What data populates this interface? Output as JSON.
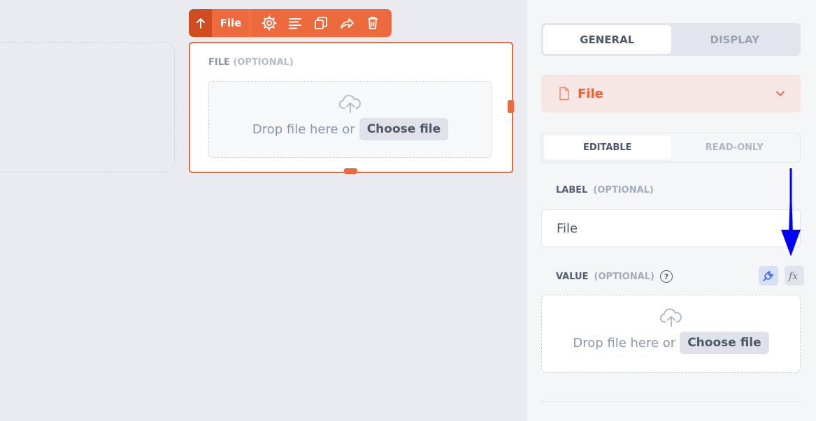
{
  "toolbar": {
    "field_name": "File",
    "icons": [
      "arrow-up-icon",
      "gear-icon",
      "align-left-icon",
      "copy-icon",
      "share-icon",
      "trash-icon"
    ]
  },
  "canvas_field": {
    "label": "FILE",
    "optional": "(OPTIONAL)",
    "drop_text": "Drop file here or",
    "choose_label": "Choose file"
  },
  "panel": {
    "tabs": [
      {
        "label": "GENERAL",
        "active": true
      },
      {
        "label": "DISPLAY",
        "active": false
      }
    ],
    "element_type": {
      "label": "File",
      "icon": "file-icon"
    },
    "mode": [
      {
        "label": "EDITABLE",
        "active": true
      },
      {
        "label": "READ-ONLY",
        "active": false
      }
    ],
    "label_section": {
      "label": "LABEL",
      "optional": "(OPTIONAL)",
      "value": "File"
    },
    "value_section": {
      "label": "VALUE",
      "optional": "(OPTIONAL)",
      "help": "?",
      "drop_text": "Drop file here or",
      "choose_label": "Choose file"
    }
  },
  "colors": {
    "accent": "#ec6a3e",
    "accent_dark": "#d04d22",
    "annotation_arrow": "#0000ff"
  }
}
